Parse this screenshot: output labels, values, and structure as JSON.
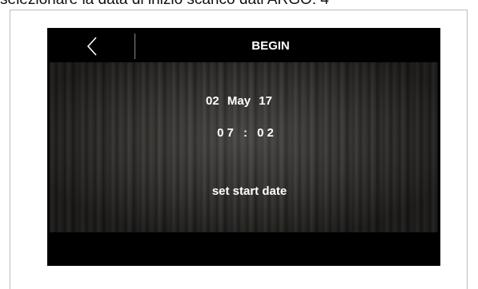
{
  "caption": "selezionare la data di inizio scarico dati ARGO: 4",
  "header": {
    "title": "BEGIN",
    "back_icon": "chevron-left-icon"
  },
  "datetime": {
    "date": "02 May 17",
    "time": "07 : 02"
  },
  "prompt": "set start date",
  "colors": {
    "bar": "#000000",
    "text": "#ffffff",
    "frame_border": "#bdbdbd"
  }
}
